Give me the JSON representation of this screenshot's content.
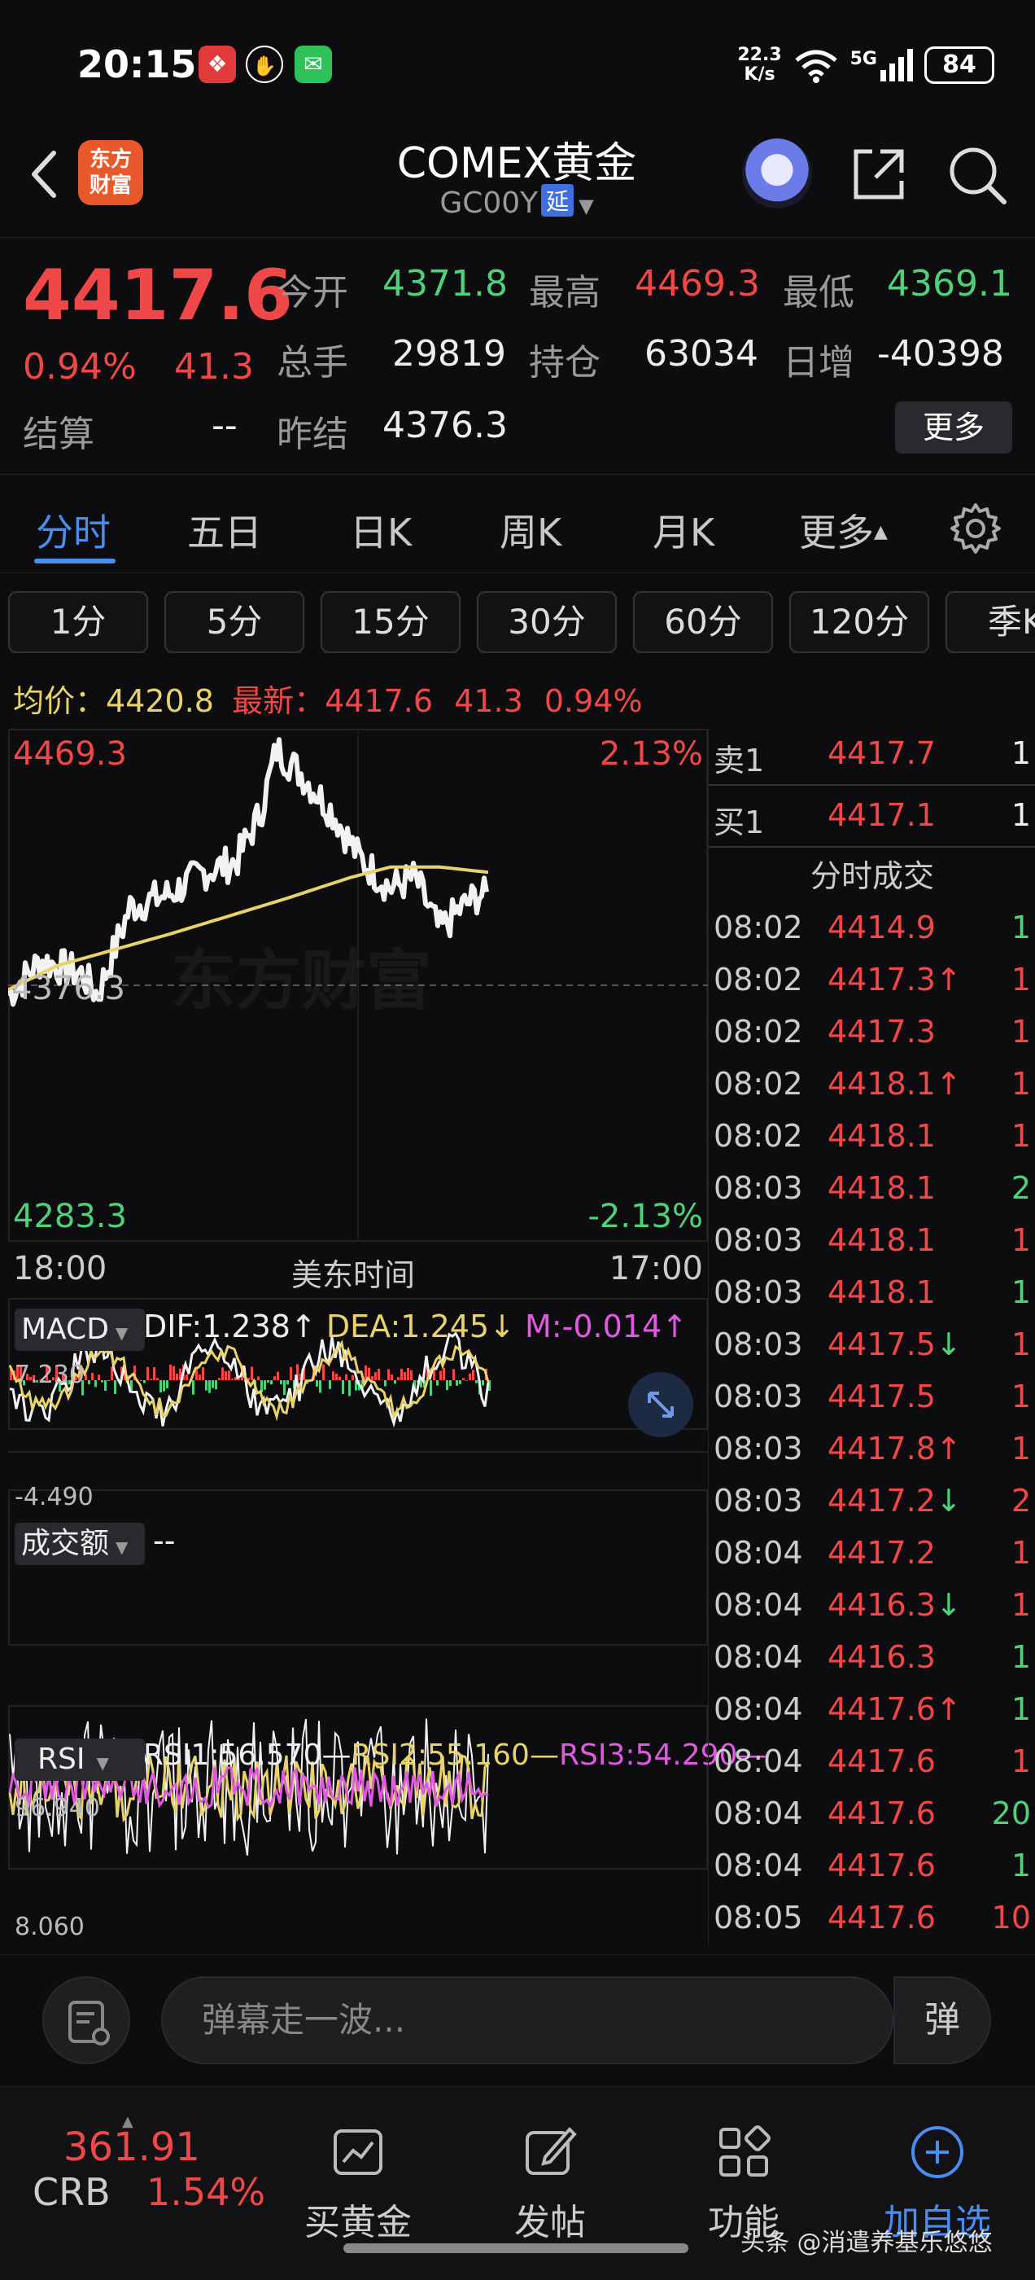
{
  "status_bar": {
    "time": "20:15",
    "net_speed_value": "22.3",
    "net_speed_unit": "K/s",
    "network": "5G",
    "battery": "84"
  },
  "header": {
    "logo_line1": "东方",
    "logo_line2": "财富",
    "title": "COMEX黄金",
    "code": "GC00Y",
    "delay_badge": "延"
  },
  "quote": {
    "last": "4417.6",
    "change_pct": "0.94%",
    "change": "41.3",
    "settle_label": "结算",
    "settle_value": "--",
    "fields": [
      {
        "label": "今开",
        "value": "4371.8"
      },
      {
        "label": "最高",
        "value": "4469.3"
      },
      {
        "label": "最低",
        "value": "4369.1"
      },
      {
        "label": "总手",
        "value": "29819"
      },
      {
        "label": "持仓",
        "value": "63034"
      },
      {
        "label": "日增",
        "value": "-40398"
      },
      {
        "label": "昨结",
        "value": "4376.3"
      }
    ],
    "more_label": "更多"
  },
  "tabs": [
    "分时",
    "五日",
    "日K",
    "周K",
    "月K",
    "更多"
  ],
  "periods": [
    "1分",
    "5分",
    "15分",
    "30分",
    "60分",
    "120分",
    "季K"
  ],
  "avg_row": {
    "avg_label": "均价：",
    "avg_value": "4420.8",
    "latest_label": "最新：",
    "latest_value": "4417.6",
    "latest_change": "41.3",
    "latest_pct": "0.94%"
  },
  "main_chart": {
    "y_top": "4469.3",
    "y_mid": "4376.3",
    "y_bottom": "4283.3",
    "pct_top": "2.13%",
    "pct_bottom": "-2.13%",
    "x_start": "18:00",
    "x_mid": "美东时间",
    "x_end": "17:00",
    "watermark": "东方财富"
  },
  "macd": {
    "label": "MACD",
    "dif": "DIF:1.238",
    "dea": "DEA:1.245",
    "m": "M:-0.014",
    "y_top": "7.230",
    "y_bottom": "-4.490"
  },
  "volume": {
    "label": "成交额",
    "value": "--"
  },
  "rsi": {
    "label": "RSI",
    "rsi1": "RSI1:56.570",
    "rsi2": "RSI2:55.160",
    "rsi3": "RSI3:54.290",
    "y_top": "96.940",
    "y_bottom": "8.060"
  },
  "orderbook": {
    "ask_label": "卖1",
    "ask_price": "4417.7",
    "ask_qty": "1",
    "bid_label": "买1",
    "bid_price": "4417.1",
    "bid_qty": "1",
    "trades_title": "分时成交"
  },
  "trades": [
    {
      "time": "08:02",
      "price": "4414.9",
      "arrow": "",
      "qty": "1",
      "qty_color": "green"
    },
    {
      "time": "08:02",
      "price": "4417.3",
      "arrow": "↑",
      "qty": "1",
      "qty_color": "red"
    },
    {
      "time": "08:02",
      "price": "4417.3",
      "arrow": "",
      "qty": "1",
      "qty_color": "red"
    },
    {
      "time": "08:02",
      "price": "4418.1",
      "arrow": "↑",
      "qty": "1",
      "qty_color": "red"
    },
    {
      "time": "08:02",
      "price": "4418.1",
      "arrow": "",
      "qty": "1",
      "qty_color": "red"
    },
    {
      "time": "08:03",
      "price": "4418.1",
      "arrow": "",
      "qty": "2",
      "qty_color": "green"
    },
    {
      "time": "08:03",
      "price": "4418.1",
      "arrow": "",
      "qty": "1",
      "qty_color": "red"
    },
    {
      "time": "08:03",
      "price": "4418.1",
      "arrow": "",
      "qty": "1",
      "qty_color": "green"
    },
    {
      "time": "08:03",
      "price": "4417.5",
      "arrow": "↓",
      "qty": "1",
      "qty_color": "red"
    },
    {
      "time": "08:03",
      "price": "4417.5",
      "arrow": "",
      "qty": "1",
      "qty_color": "red"
    },
    {
      "time": "08:03",
      "price": "4417.8",
      "arrow": "↑",
      "qty": "1",
      "qty_color": "red"
    },
    {
      "time": "08:03",
      "price": "4417.2",
      "arrow": "↓",
      "qty": "2",
      "qty_color": "red"
    },
    {
      "time": "08:04",
      "price": "4417.2",
      "arrow": "",
      "qty": "1",
      "qty_color": "red"
    },
    {
      "time": "08:04",
      "price": "4416.3",
      "arrow": "↓",
      "qty": "1",
      "qty_color": "red"
    },
    {
      "time": "08:04",
      "price": "4416.3",
      "arrow": "",
      "qty": "1",
      "qty_color": "green"
    },
    {
      "time": "08:04",
      "price": "4417.6",
      "arrow": "↑",
      "qty": "1",
      "qty_color": "green"
    },
    {
      "time": "08:04",
      "price": "4417.6",
      "arrow": "",
      "qty": "1",
      "qty_color": "red"
    },
    {
      "time": "08:04",
      "price": "4417.6",
      "arrow": "",
      "qty": "20",
      "qty_color": "green"
    },
    {
      "time": "08:04",
      "price": "4417.6",
      "arrow": "",
      "qty": "1",
      "qty_color": "green"
    },
    {
      "time": "08:05",
      "price": "4417.6",
      "arrow": "",
      "qty": "10",
      "qty_color": "red"
    }
  ],
  "danmaku": {
    "placeholder": "弹幕走一波...",
    "send_label": "弹"
  },
  "bottom_nav": {
    "crb_value": "361.91",
    "crb_label": "CRB",
    "crb_pct": "1.54%",
    "items": [
      "买黄金",
      "发帖",
      "功能",
      "加自选"
    ]
  },
  "watermark": "头条 @消遣养基乐悠悠",
  "colors": {
    "up": "#f04848",
    "down": "#4ed17a",
    "accent": "#4a8cf0",
    "avg_line": "#e8d36a",
    "rsi2": "#e8d36a",
    "rsi3": "#e05ae0"
  }
}
